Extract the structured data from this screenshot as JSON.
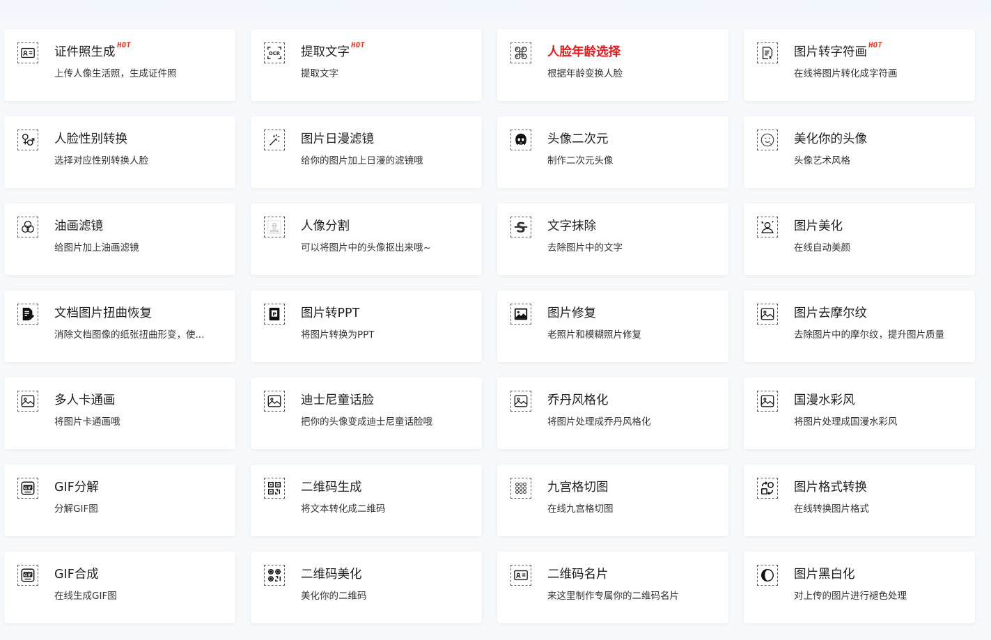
{
  "hot_badge": "HOT",
  "colors": {
    "highlight_title": "#e8191c",
    "hot_badge": "#ff2a1a",
    "card_bg": "#ffffff",
    "page_bg": "#f7f8fa"
  },
  "tools": [
    {
      "title": "证件照生成",
      "subtitle": "上传人像生活照，生成证件照",
      "icon": "id-card-icon",
      "hot": true
    },
    {
      "title": "提取文字",
      "subtitle": "提取文字",
      "icon": "ocr-icon",
      "hot": true
    },
    {
      "title": "人脸年龄选择",
      "subtitle": "根据年龄变换人脸",
      "icon": "face-age-icon",
      "highlight": true
    },
    {
      "title": "图片转字符画",
      "subtitle": "在线将图片转化成字符画",
      "icon": "char-art-icon",
      "hot": true
    },
    {
      "title": "人脸性别转换",
      "subtitle": "选择对应性别转换人脸",
      "icon": "gender-icon"
    },
    {
      "title": "图片日漫滤镜",
      "subtitle": "给你的图片加上日漫的滤镜哦",
      "icon": "magic-wand-icon"
    },
    {
      "title": "头像二次元",
      "subtitle": "制作二次元头像",
      "icon": "anime-avatar-icon"
    },
    {
      "title": "美化你的头像",
      "subtitle": "头像艺术风格",
      "icon": "smile-face-icon"
    },
    {
      "title": "油画滤镜",
      "subtitle": "给图片加上油画滤镜",
      "icon": "color-circles-icon"
    },
    {
      "title": "人像分割",
      "subtitle": "可以将图片中的头像抠出来哦~",
      "icon": "portrait-segment-icon"
    },
    {
      "title": "文字抹除",
      "subtitle": "去除图片中的文字",
      "icon": "text-erase-icon"
    },
    {
      "title": "图片美化",
      "subtitle": "在线自动美颜",
      "icon": "beautify-person-icon"
    },
    {
      "title": "文档图片扭曲恢复",
      "subtitle": "消除文档图像的纸张扭曲形变，使...",
      "icon": "document-edit-icon"
    },
    {
      "title": "图片转PPT",
      "subtitle": "将图片转换为PPT",
      "icon": "ppt-icon"
    },
    {
      "title": "图片修复",
      "subtitle": "老照片和模糊照片修复",
      "icon": "photo-repair-icon"
    },
    {
      "title": "图片去摩尔纹",
      "subtitle": "去除图片中的摩尔纹，提升图片质量",
      "icon": "image-icon"
    },
    {
      "title": "多人卡通画",
      "subtitle": "将图片卡通画哦",
      "icon": "image-icon"
    },
    {
      "title": "迪士尼童话脸",
      "subtitle": "把你的头像变成迪士尼童话脸哦",
      "icon": "image-icon"
    },
    {
      "title": "乔丹风格化",
      "subtitle": "将图片处理成乔丹风格化",
      "icon": "image-icon"
    },
    {
      "title": "国漫水彩风",
      "subtitle": "将图片处理成国漫水彩风",
      "icon": "image-icon"
    },
    {
      "title": "GIF分解",
      "subtitle": "分解GIF图",
      "icon": "gif-icon"
    },
    {
      "title": "二维码生成",
      "subtitle": "将文本转化成二维码",
      "icon": "qr-code-icon"
    },
    {
      "title": "九宫格切图",
      "subtitle": "在线九宫格切图",
      "icon": "nine-grid-icon"
    },
    {
      "title": "图片格式转换",
      "subtitle": "在线转换图片格式",
      "icon": "format-convert-icon"
    },
    {
      "title": "GIF合成",
      "subtitle": "在线生成GIF图",
      "icon": "gif-icon"
    },
    {
      "title": "二维码美化",
      "subtitle": "美化你的二维码",
      "icon": "qr-beautify-icon"
    },
    {
      "title": "二维码名片",
      "subtitle": "来这里制作专属你的二维码名片",
      "icon": "id-card-icon"
    },
    {
      "title": "图片黑白化",
      "subtitle": "对上传的图片进行褪色处理",
      "icon": "black-white-icon"
    }
  ]
}
